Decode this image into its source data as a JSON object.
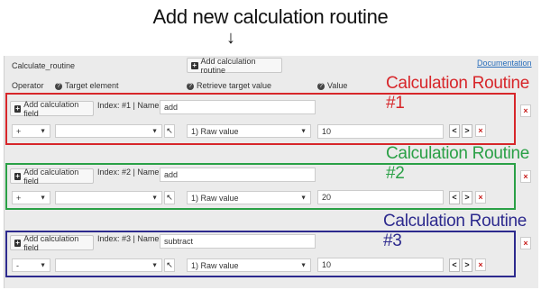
{
  "annotation": {
    "top_label": "Add new calculation routine",
    "arrow": "↓"
  },
  "header": {
    "field_name": "Calculate_routine",
    "add_routine_label": "Add calculation routine",
    "documentation_label": "Documentation"
  },
  "columns": {
    "operator": "Operator",
    "target_element": "Target element",
    "retrieve_target_value": "Retrieve target value",
    "value": "Value"
  },
  "colors": {
    "routine1": "#d7262a",
    "routine2": "#2aa046",
    "routine3": "#2d2a8e",
    "link": "#2a6ebb",
    "delete": "#c8201e"
  },
  "icons": {
    "plus": "plus-icon",
    "help": "help-icon",
    "pointer": "pointer-icon",
    "prev": "chevron-left-icon",
    "next": "chevron-right-icon",
    "delete": "close-icon"
  },
  "routines": [
    {
      "label": "Calculation Routine #1",
      "add_field_label": "Add calculation field",
      "index_label": "Index: #1 | Name:",
      "name": "add",
      "operator": "+",
      "target_element": "",
      "retrieve": "1) Raw value",
      "value": "10",
      "prev": "<",
      "next": ">",
      "delete": "×"
    },
    {
      "label": "Calculation Routine #2",
      "add_field_label": "Add calculation field",
      "index_label": "Index: #2 | Name:",
      "name": "add",
      "operator": "+",
      "target_element": "",
      "retrieve": "1) Raw value",
      "value": "20",
      "prev": "<",
      "next": ">",
      "delete": "×"
    },
    {
      "label": "Calculation Routine #3",
      "add_field_label": "Add calculation field",
      "index_label": "Index: #3 | Name:",
      "name": "subtract",
      "operator": "-",
      "target_element": "",
      "retrieve": "1) Raw value",
      "value": "10",
      "prev": "<",
      "next": ">",
      "delete": "×"
    }
  ]
}
